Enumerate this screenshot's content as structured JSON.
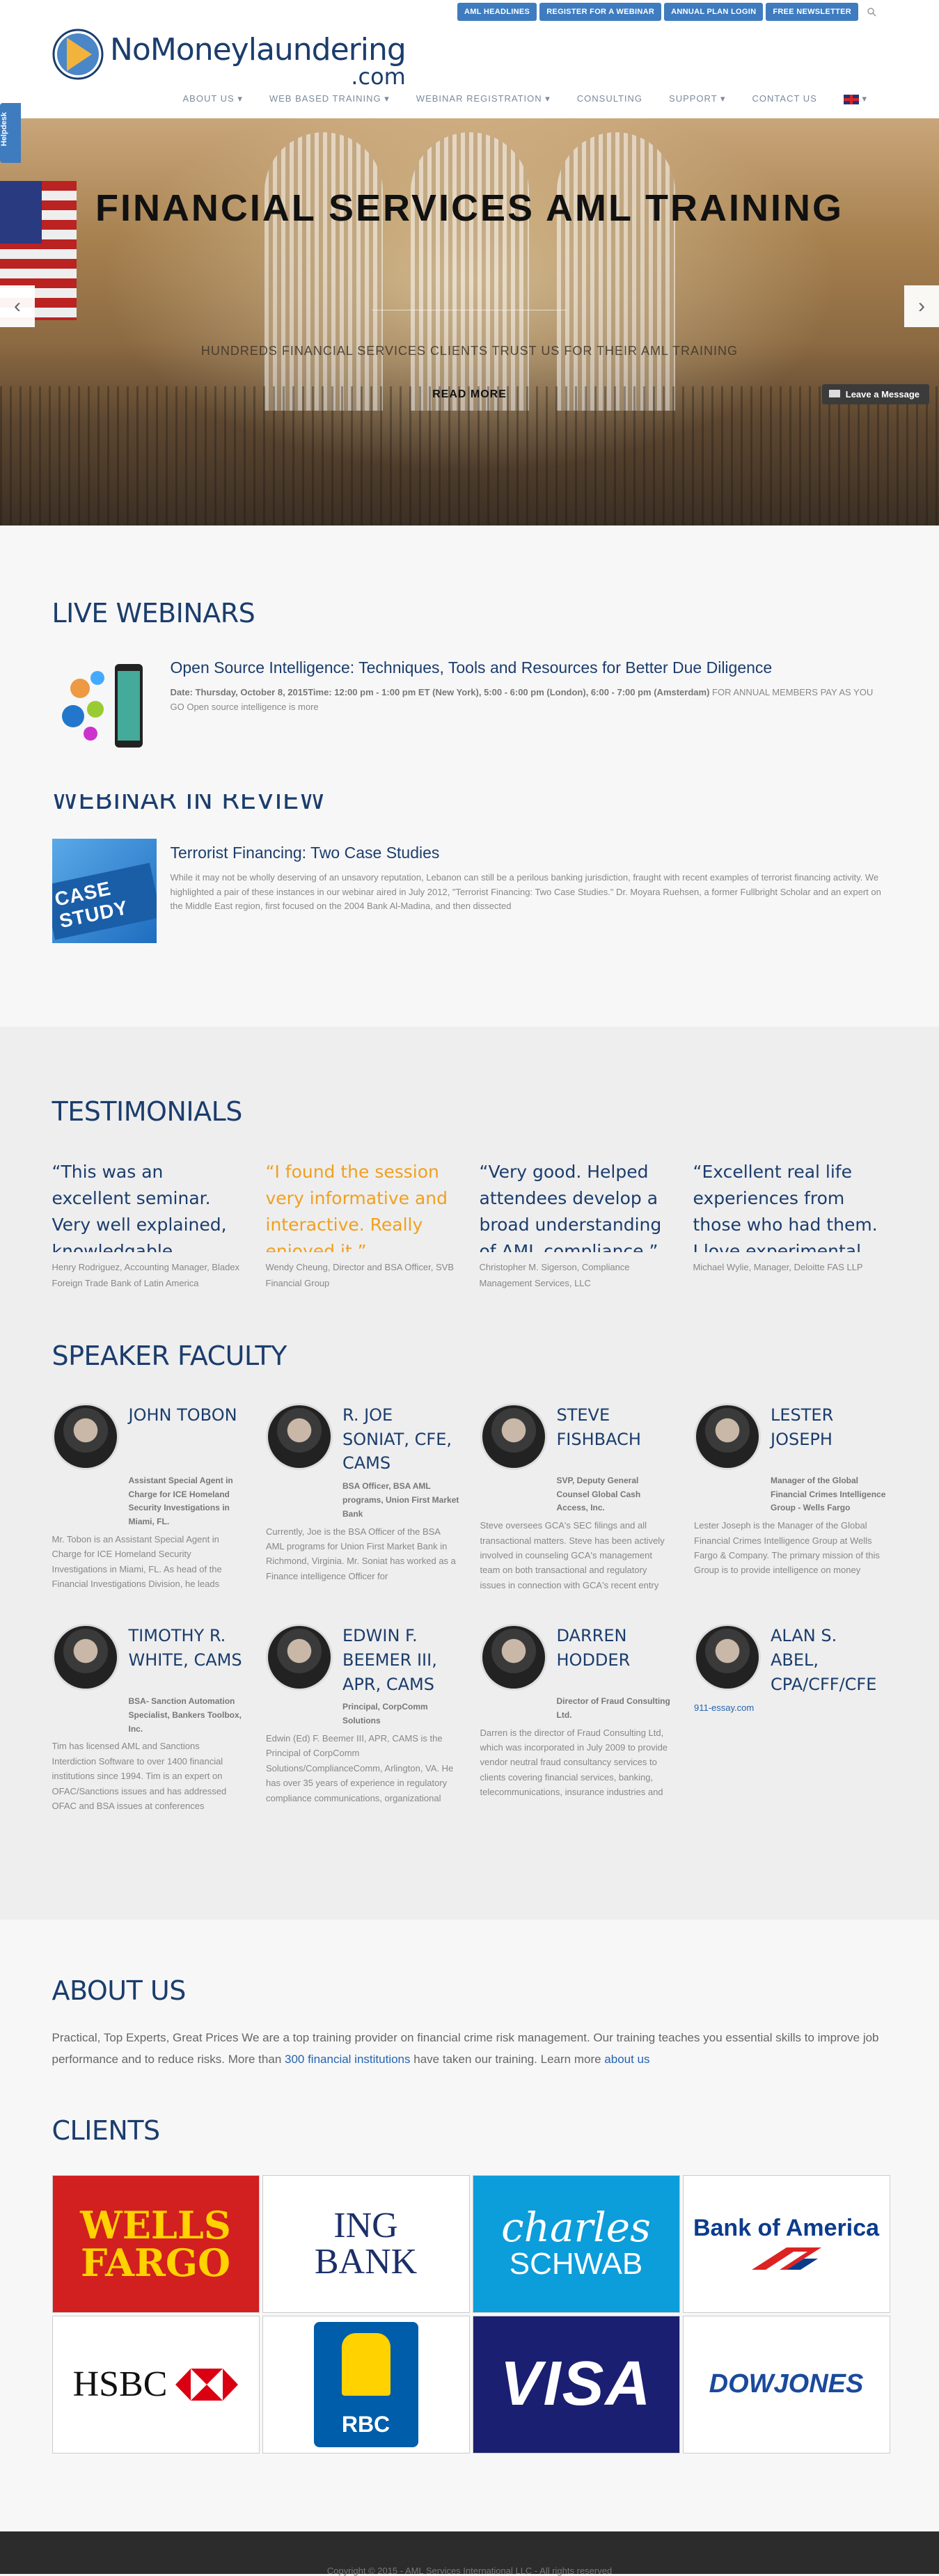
{
  "topbar": {
    "buttons": [
      "AML HEADLINES",
      "REGISTER FOR A WEBINAR",
      "ANNUAL PLAN LOGIN",
      "FREE NEWSLETTER"
    ]
  },
  "logo": {
    "title": "NoMoneylaundering",
    "sub": ".com"
  },
  "nav": [
    "ABOUT US",
    "WEB BASED TRAINING",
    "WEBINAR REGISTRATION",
    "CONSULTING",
    "SUPPORT",
    "CONTACT US"
  ],
  "helpdesk": "Helpdesk",
  "hero": {
    "title": "FINANCIAL SERVICES AML TRAINING",
    "subtitle": "HUNDREDS FINANCIAL SERVICES CLIENTS TRUST US FOR THEIR AML TRAINING",
    "read_more": "READ MORE",
    "leave_message": "Leave a Message"
  },
  "live_webinars": {
    "title": "LIVE WEBINARS",
    "item": {
      "title": "Open Source Intelligence: Techniques, Tools and Resources for Better Due Diligence",
      "meta_bold": "Date: Thursday, October 8, 2015Time: 12:00 pm - 1:00 pm ET (New York), 5:00 - 6:00 pm (London), 6:00 - 7:00 pm (Amsterdam)",
      "meta": " FOR ANNUAL MEMBERS PAY AS YOU GO Open source intelligence is more"
    },
    "review_title": "WEBINAR IN REVIEW",
    "review": {
      "thumb_text": "CASE STUDY",
      "title": "Terrorist Financing: Two Case Studies",
      "text": "While it may not be wholly deserving of an unsavory reputation, Lebanon can still be a perilous banking jurisdiction, fraught with recent examples of terrorist financing activity. We highlighted a pair of these instances in our webinar aired in July 2012, \"Terrorist Financing: Two Case Studies.\" Dr. Moyara Ruehsen, a former Fullbright Scholar and an expert on the Middle East region, first focused on the 2004 Bank Al-Madina, and then dissected"
    }
  },
  "testimonials": {
    "title": "TESTIMONIALS",
    "items": [
      {
        "quote": "“This was an excellent seminar. Very well explained, knowledgable people.”",
        "by": "Henry Rodriguez, Accounting Manager, Bladex Foreign Trade Bank of Latin America"
      },
      {
        "quote": "“I found the session very informative and interactive. Really enjoyed it.”",
        "by": "Wendy Cheung, Director and BSA Officer, SVB Financial Group"
      },
      {
        "quote": "“Very good. Helped attendees develop a broad understanding of AML compliance.”",
        "by": "Christopher M. Sigerson, Compliance Management Services, LLC"
      },
      {
        "quote": "“Excellent real life experiences from those who had them. I love experimental learning.”",
        "by": "Michael Wylie, Manager, Deloitte FAS LLP"
      }
    ]
  },
  "faculty": {
    "title": "SPEAKER FACULTY",
    "items": [
      {
        "name": "JOHN TOBON",
        "role": "Assistant Special Agent in Charge for ICE Homeland Security Investigations in Miami, FL.",
        "bio": "Mr. Tobon is an Assistant Special Agent in Charge for ICE Homeland Security Investigations in Miami, FL. As head of the Financial Investigations Division, he leads"
      },
      {
        "name": "R. JOE SONIAT, CFE, CAMS",
        "role": "BSA Officer, BSA AML programs, Union First Market Bank",
        "bio": "Currently, Joe is the BSA Officer of the BSA AML programs for Union First Market Bank in Richmond, Virginia. Mr. Soniat has worked as a Finance intelligence Officer for"
      },
      {
        "name": "STEVE FISHBACH",
        "role": "SVP, Deputy General Counsel Global Cash Access, Inc.",
        "bio": "Steve oversees GCA's SEC filings and all transactional matters. Steve has been actively involved in counseling GCA's management team on both transactional and regulatory issues in connection with GCA's recent entry into"
      },
      {
        "name": "LESTER JOSEPH",
        "role": "Manager of the Global Financial Crimes Intelligence Group - Wells Fargo",
        "bio": "Lester Joseph is the Manager of the Global Financial Crimes Intelligence Group at Wells Fargo & Company. The primary mission of this Group is to provide intelligence on money"
      },
      {
        "name": "TIMOTHY R. WHITE, CAMS",
        "role": "BSA- Sanction Automation Specialist, Bankers Toolbox, Inc.",
        "bio": "Tim has licensed AML and Sanctions Interdiction Software to over 1400 financial institutions since 1994. Tim is an expert on OFAC/Sanctions issues and has addressed OFAC and BSA issues at conferences throughout the"
      },
      {
        "name": "EDWIN F. BEEMER III, APR, CAMS",
        "role": "Principal, CorpComm Solutions",
        "bio": "Edwin (Ed) F. Beemer III, APR, CAMS is the Principal of CorpComm Solutions/ComplianceComm, Arlington, VA. He has over 35 years of experience in regulatory compliance communications, organizational communications, change management, technical communications and technical training development and"
      },
      {
        "name": "DARREN HODDER",
        "role": "Director of Fraud Consulting Ltd.",
        "bio": "Darren is the director of Fraud Consulting Ltd, which was incorporated in July 2009 to provide vendor neutral fraud consultancy services to clients covering financial services, banking, telecommunications, insurance industries and public sector bodies, both"
      },
      {
        "name": "ALAN S. ABEL, CPA/CFF/CFE",
        "role": "",
        "bio": "911-essay.com"
      }
    ]
  },
  "about": {
    "title": "ABOUT US",
    "text_1": "Practical, Top Experts, Great Prices We are a top training provider on financial crime risk management. Our training teaches you essential skills to improve job performance and to reduce risks. More than ",
    "link_1": "300 financial institutions",
    "text_2": " have taken our training. Learn more ",
    "link_2": "about us"
  },
  "clients": {
    "title": "CLIENTS",
    "logos": [
      {
        "name": "wells-fargo",
        "line1": "WELLS",
        "line2": "FARGO"
      },
      {
        "name": "ing-bank",
        "line1": "ING",
        "line2": "BANK"
      },
      {
        "name": "charles-schwab",
        "line1": "charles",
        "line2": "SCHWAB"
      },
      {
        "name": "bank-of-america",
        "line1": "Bank of America",
        "line2": ""
      },
      {
        "name": "hsbc",
        "line1": "HSBC",
        "line2": ""
      },
      {
        "name": "rbc",
        "line1": "RBC",
        "line2": ""
      },
      {
        "name": "visa",
        "line1": "VISA",
        "line2": ""
      },
      {
        "name": "dow-jones",
        "line1": "DOWJONES",
        "line2": ""
      }
    ]
  },
  "footer": {
    "text": "Copyright © 2015   -   AML Services International LLC   -   All rights reserved"
  },
  "colors": {
    "accent": "#3e7cbf",
    "brand": "#1b3d6d",
    "orange": "#f0a020"
  }
}
